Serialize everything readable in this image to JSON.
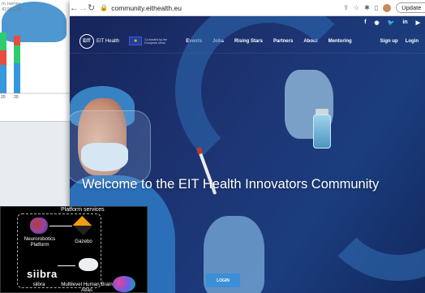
{
  "back_window": {
    "caption_line1": "m (series",
    "caption_line2": "4100—25",
    "ticks": [
      "20",
      "20"
    ],
    "colors": {
      "red": "#e74c3c",
      "green": "#2ecc71",
      "blue": "#3498db"
    }
  },
  "browser": {
    "url": "community.eithealth.eu",
    "update_label": "Update",
    "icons": [
      "back-icon",
      "forward-icon",
      "reload-icon",
      "lock-icon",
      "share-icon",
      "star-icon",
      "extensions-icon",
      "sidebar-icon",
      "profile-icon",
      "more-icon"
    ]
  },
  "site": {
    "social": [
      "f",
      "◉",
      "🐦",
      "in",
      "▶"
    ],
    "logo_text": "EIT Health",
    "logo_circle": "EIT",
    "eu_text": "Co-funded by the European Union",
    "menu": [
      "Events",
      "Jobs",
      "Rising Stars",
      "Partners",
      "About",
      "Mentoring"
    ],
    "auth": [
      "Sign up",
      "Login"
    ],
    "hero_title": "Welcome to the EIT Health Innovators Community",
    "login_button": "LOGIN",
    "colors": {
      "navy": "#16245a",
      "accent": "#3a8fd6"
    }
  },
  "diagram": {
    "title": "Platform services",
    "nodes": {
      "neurorobotics": "Neurorobotics Platform",
      "gazebo": "Gazebo",
      "siibra_logo": "siibra",
      "siibra_label": "siibra",
      "atlas": "Multilevel Human Brain Atlas"
    }
  }
}
